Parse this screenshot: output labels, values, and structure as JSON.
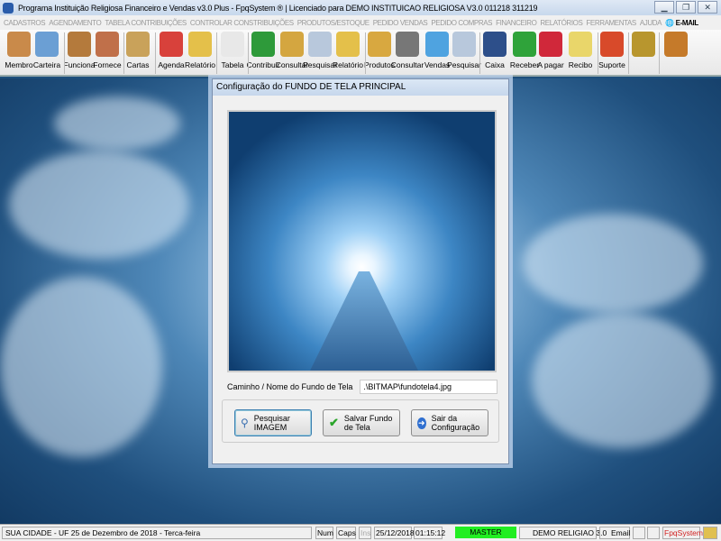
{
  "window": {
    "title": "Programa Instituição Religiosa Financeiro e Vendas v3.0 Plus - FpqSystem ® | Licenciado para  DEMO INSTITUICAO RELIGIOSA V3.0 011218 311219"
  },
  "menu": [
    "CADASTROS",
    "AGENDAMENTO",
    "TABELA CONTRIBUIÇÕES",
    "CONTROLAR CONSTRIBUIÇÕES",
    "PRODUTOS/ESTOQUE",
    "PEDIDO VENDAS",
    "PEDIDO COMPRAS",
    "FINANCEIRO",
    "RELATÓRIOS",
    "FERRAMENTAS",
    "AJUDA"
  ],
  "menu_email": "E-MAIL",
  "toolbar": [
    {
      "label": "Membro",
      "icon": "members-icon",
      "color": "#c98a4a"
    },
    {
      "label": "Carteira",
      "icon": "id-card-icon",
      "color": "#6b9fd4"
    },
    {
      "label": "Funciona",
      "icon": "employees-icon",
      "color": "#b47a3c"
    },
    {
      "label": "Fornece",
      "icon": "supplier-icon",
      "color": "#c0704a"
    },
    {
      "label": "Cartas",
      "icon": "scroll-icon",
      "color": "#c9a25a"
    },
    {
      "label": "Agenda",
      "icon": "calendar-icon",
      "color": "#d8413b"
    },
    {
      "label": "Relatório",
      "icon": "report-icon",
      "color": "#e4c04a"
    },
    {
      "label": "Tabela",
      "icon": "table-doc-icon",
      "color": "#e8e8e8"
    },
    {
      "label": "Contribuir",
      "icon": "dollar-icon",
      "color": "#2e9a3a"
    },
    {
      "label": "Consultar",
      "icon": "file-box-icon",
      "color": "#d4a640"
    },
    {
      "label": "Pesquisar",
      "icon": "search-doc-icon",
      "color": "#b8c8dc"
    },
    {
      "label": "Relatório",
      "icon": "report-icon",
      "color": "#e4c04a"
    },
    {
      "label": "Produtos",
      "icon": "boxes-icon",
      "color": "#d8a840"
    },
    {
      "label": "Consultar",
      "icon": "barcode-icon",
      "color": "#777"
    },
    {
      "label": "Vendas",
      "icon": "monitor-icon",
      "color": "#4fa3e0"
    },
    {
      "label": "Pesquisar",
      "icon": "search-doc-icon",
      "color": "#b8c8dc"
    },
    {
      "label": "Caixa",
      "icon": "cash-book-icon",
      "color": "#2d4f8a"
    },
    {
      "label": "Receber",
      "icon": "receive-icon",
      "color": "#2fa33a"
    },
    {
      "label": "A pagar",
      "icon": "pay-icon",
      "color": "#d0283a"
    },
    {
      "label": "Recibo",
      "icon": "receipt-icon",
      "color": "#e9d66a"
    },
    {
      "label": "Suporte",
      "icon": "support-icon",
      "color": "#d84a2a"
    },
    {
      "label": "",
      "icon": "coin-icon",
      "color": "#b8962e"
    },
    {
      "label": "",
      "icon": "exit-icon",
      "color": "#c57a2a"
    }
  ],
  "dialog": {
    "title": "Configuração do FUNDO DE TELA PRINCIPAL",
    "path_label": "Caminho / Nome do Fundo de Tela",
    "path_value": ".\\BITMAP\\fundotela4.jpg",
    "btn_search": "Pesquisar IMAGEM",
    "btn_save": "Salvar Fundo de Tela",
    "btn_exit": "Sair da Configuração"
  },
  "status": {
    "city": "SUA CIDADE - UF 25 de Dezembro de 2018 - Terca-feira",
    "num": "Num",
    "caps": "Caps",
    "ins": "Ins",
    "date": "25/12/2018",
    "time": "01:15:12",
    "user": "MASTER",
    "company": "DEMO RELIGIAO 3.0",
    "email": "Email",
    "brand": "FpqSystem"
  }
}
